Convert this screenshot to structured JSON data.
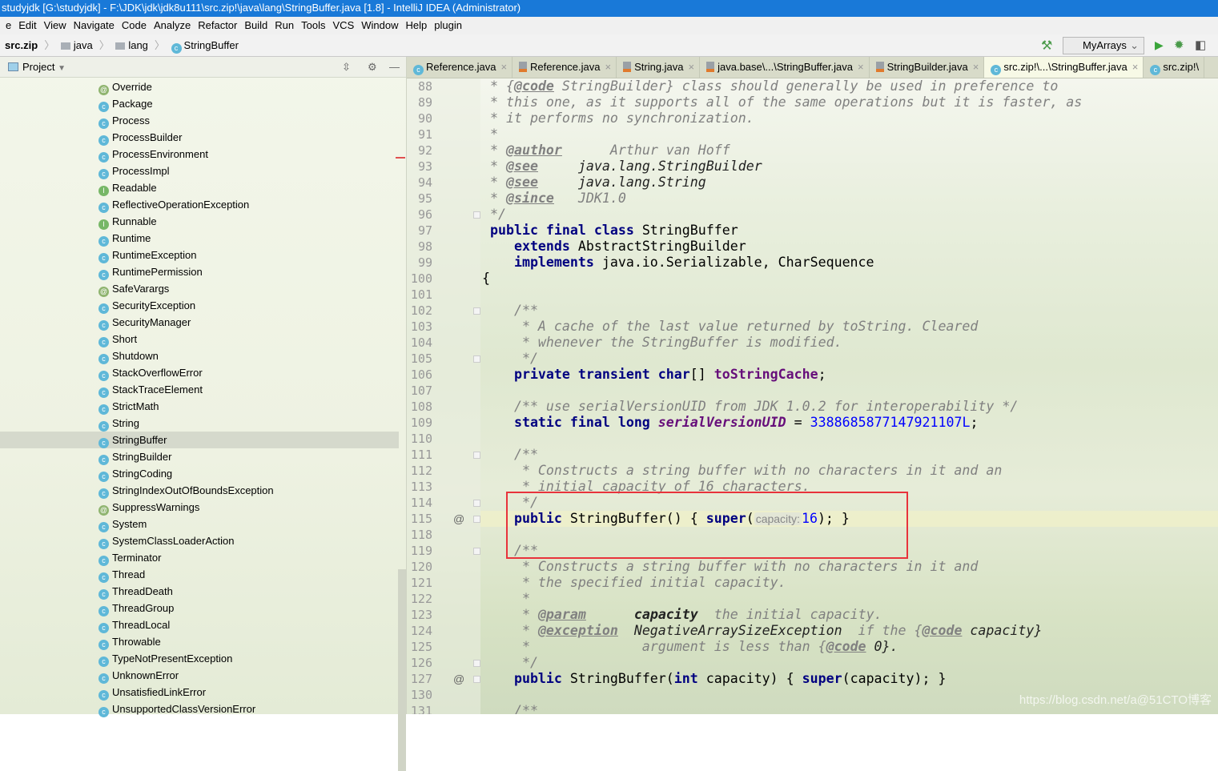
{
  "window": {
    "title": "studyjdk [G:\\studyjdk] - F:\\JDK\\jdk\\jdk8u111\\src.zip!\\java\\lang\\StringBuffer.java [1.8] - IntelliJ IDEA (Administrator)"
  },
  "menu": [
    "e",
    "Edit",
    "View",
    "Navigate",
    "Code",
    "Analyze",
    "Refactor",
    "Build",
    "Run",
    "Tools",
    "VCS",
    "Window",
    "Help",
    "plugin"
  ],
  "breadcrumb": [
    "src.zip",
    "java",
    "lang",
    "StringBuffer"
  ],
  "toolbar": {
    "run_config": "MyArrays"
  },
  "project": {
    "label": "Project"
  },
  "tree": [
    {
      "t": "A",
      "n": "Override"
    },
    {
      "t": "C",
      "n": "Package"
    },
    {
      "t": "C",
      "n": "Process"
    },
    {
      "t": "C",
      "n": "ProcessBuilder"
    },
    {
      "t": "C",
      "n": "ProcessEnvironment"
    },
    {
      "t": "C",
      "n": "ProcessImpl"
    },
    {
      "t": "I",
      "n": "Readable"
    },
    {
      "t": "C",
      "n": "ReflectiveOperationException"
    },
    {
      "t": "I",
      "n": "Runnable"
    },
    {
      "t": "C",
      "n": "Runtime"
    },
    {
      "t": "C",
      "n": "RuntimeException"
    },
    {
      "t": "C",
      "n": "RuntimePermission"
    },
    {
      "t": "A",
      "n": "SafeVarargs"
    },
    {
      "t": "C",
      "n": "SecurityException"
    },
    {
      "t": "C",
      "n": "SecurityManager"
    },
    {
      "t": "C",
      "n": "Short"
    },
    {
      "t": "C",
      "n": "Shutdown"
    },
    {
      "t": "C",
      "n": "StackOverflowError"
    },
    {
      "t": "C",
      "n": "StackTraceElement"
    },
    {
      "t": "C",
      "n": "StrictMath"
    },
    {
      "t": "C",
      "n": "String"
    },
    {
      "t": "C",
      "n": "StringBuffer",
      "selected": true
    },
    {
      "t": "C",
      "n": "StringBuilder"
    },
    {
      "t": "C",
      "n": "StringCoding"
    },
    {
      "t": "C",
      "n": "StringIndexOutOfBoundsException"
    },
    {
      "t": "A",
      "n": "SuppressWarnings"
    },
    {
      "t": "C",
      "n": "System"
    },
    {
      "t": "C",
      "n": "SystemClassLoaderAction"
    },
    {
      "t": "C",
      "n": "Terminator"
    },
    {
      "t": "C",
      "n": "Thread"
    },
    {
      "t": "C",
      "n": "ThreadDeath"
    },
    {
      "t": "C",
      "n": "ThreadGroup"
    },
    {
      "t": "C",
      "n": "ThreadLocal"
    },
    {
      "t": "C",
      "n": "Throwable"
    },
    {
      "t": "C",
      "n": "TypeNotPresentException"
    },
    {
      "t": "C",
      "n": "UnknownError"
    },
    {
      "t": "C",
      "n": "UnsatisfiedLinkError"
    },
    {
      "t": "C",
      "n": "UnsupportedClassVersionError"
    }
  ],
  "tabs": [
    {
      "label": "Reference.java",
      "icon": "c"
    },
    {
      "label": "Reference.java",
      "icon": "j"
    },
    {
      "label": "String.java",
      "icon": "j"
    },
    {
      "label": "java.base\\...\\StringBuffer.java",
      "icon": "j"
    },
    {
      "label": "StringBuilder.java",
      "icon": "j"
    },
    {
      "label": "src.zip!\\...\\StringBuffer.java",
      "icon": "c",
      "active": true
    },
    {
      "label": "src.zip!\\",
      "icon": "c"
    }
  ],
  "editor": {
    "lines": [
      {
        "no": "88",
        "s": [
          [
            " * {",
            "c"
          ],
          [
            "@code",
            "t"
          ],
          [
            " StringBuilder} class should generally be used in preference to",
            "c"
          ]
        ]
      },
      {
        "no": "89",
        "s": [
          [
            " * this one, as it supports all of the same operations but it is faster, as",
            "c"
          ]
        ]
      },
      {
        "no": "90",
        "s": [
          [
            " * it performs no synchronization.",
            "c"
          ]
        ]
      },
      {
        "no": "91",
        "s": [
          [
            " *",
            "c"
          ]
        ]
      },
      {
        "no": "92",
        "s": [
          [
            " * ",
            "c"
          ],
          [
            "@author",
            "t"
          ],
          [
            "      Arthur van Hoff",
            "c"
          ]
        ]
      },
      {
        "no": "93",
        "s": [
          [
            " * ",
            "c"
          ],
          [
            "@see",
            "t"
          ],
          [
            "     java.lang.StringBuilder",
            "cr"
          ]
        ]
      },
      {
        "no": "94",
        "s": [
          [
            " * ",
            "c"
          ],
          [
            "@see",
            "t"
          ],
          [
            "     java.lang.String",
            "cr"
          ]
        ]
      },
      {
        "no": "95",
        "s": [
          [
            " * ",
            "c"
          ],
          [
            "@since",
            "t"
          ],
          [
            "   JDK1.0",
            "c"
          ]
        ]
      },
      {
        "no": "96",
        "s": [
          [
            " */",
            "c"
          ]
        ],
        "fold": true
      },
      {
        "no": "97",
        "s": [
          [
            " public final class ",
            "k"
          ],
          [
            "StringBuffer",
            "n"
          ]
        ]
      },
      {
        "no": "98",
        "s": [
          [
            "    extends ",
            "k"
          ],
          [
            "AbstractStringBuilder",
            "n"
          ]
        ]
      },
      {
        "no": "99",
        "s": [
          [
            "    implements ",
            "k"
          ],
          [
            "java.io.Serializable, CharSequence",
            "n"
          ]
        ]
      },
      {
        "no": "100",
        "s": [
          [
            "{",
            "n"
          ]
        ]
      },
      {
        "no": "101",
        "s": []
      },
      {
        "no": "102",
        "s": [
          [
            "    /**",
            "c"
          ]
        ],
        "fold": true
      },
      {
        "no": "103",
        "s": [
          [
            "     * A cache of the last value returned by toString. Cleared",
            "c"
          ]
        ]
      },
      {
        "no": "104",
        "s": [
          [
            "     * whenever the StringBuffer is modified.",
            "c"
          ]
        ]
      },
      {
        "no": "105",
        "s": [
          [
            "     */",
            "c"
          ]
        ],
        "fold": true
      },
      {
        "no": "106",
        "s": [
          [
            "    private transient char",
            "k"
          ],
          [
            "[] ",
            "n"
          ],
          [
            "toStringCache",
            "p"
          ],
          [
            ";",
            "n"
          ]
        ]
      },
      {
        "no": "107",
        "s": []
      },
      {
        "no": "108",
        "s": [
          [
            "    /** use serialVersionUID from JDK 1.0.2 for interoperability */",
            "c"
          ]
        ]
      },
      {
        "no": "109",
        "s": [
          [
            "    static final long ",
            "k"
          ],
          [
            "serialVersionUID",
            "f"
          ],
          [
            " = ",
            "n"
          ],
          [
            "3388685877147921107L",
            "num"
          ],
          [
            ";",
            "n"
          ]
        ]
      },
      {
        "no": "110",
        "s": []
      },
      {
        "no": "111",
        "s": [
          [
            "    /**",
            "c"
          ]
        ],
        "fold": true
      },
      {
        "no": "112",
        "s": [
          [
            "     * Constructs a string buffer with no characters in it and an",
            "c"
          ]
        ]
      },
      {
        "no": "113",
        "s": [
          [
            "     * initial capacity of 16 characters.",
            "c"
          ]
        ]
      },
      {
        "no": "114",
        "s": [
          [
            "     */",
            "c"
          ]
        ],
        "fold": true
      },
      {
        "no": "115",
        "s": [
          [
            "    public ",
            "k"
          ],
          [
            "StringBuffer() { ",
            "n"
          ],
          [
            "super",
            "k"
          ],
          [
            "(",
            "n"
          ],
          [
            "capacity:",
            "h"
          ],
          [
            "16",
            "num"
          ],
          [
            "); }",
            "n"
          ]
        ],
        "mark": "@",
        "fold": true,
        "current": true
      },
      {
        "no": "118",
        "s": []
      },
      {
        "no": "119",
        "s": [
          [
            "    /**",
            "c"
          ]
        ],
        "fold": true
      },
      {
        "no": "120",
        "s": [
          [
            "     * Constructs a string buffer with no characters in it and",
            "c"
          ]
        ]
      },
      {
        "no": "121",
        "s": [
          [
            "     * the specified initial capacity.",
            "c"
          ]
        ]
      },
      {
        "no": "122",
        "s": [
          [
            "     *",
            "c"
          ]
        ]
      },
      {
        "no": "123",
        "s": [
          [
            "     * ",
            "c"
          ],
          [
            "@param",
            "t"
          ],
          [
            "      ",
            "c"
          ],
          [
            "capacity",
            "cb"
          ],
          [
            "  the initial capacity.",
            "c"
          ]
        ]
      },
      {
        "no": "124",
        "s": [
          [
            "     * ",
            "c"
          ],
          [
            "@exception",
            "t"
          ],
          [
            "  NegativeArraySizeException",
            "cr"
          ],
          [
            "  if the {",
            "c"
          ],
          [
            "@code",
            "t"
          ],
          [
            " capacity}",
            "cr"
          ]
        ]
      },
      {
        "no": "125",
        "s": [
          [
            "     *              argument is less than {",
            "c"
          ],
          [
            "@code",
            "t"
          ],
          [
            " 0}.",
            "cr"
          ]
        ]
      },
      {
        "no": "126",
        "s": [
          [
            "     */",
            "c"
          ]
        ],
        "fold": true
      },
      {
        "no": "127",
        "s": [
          [
            "    public ",
            "k"
          ],
          [
            "StringBuffer(",
            "n"
          ],
          [
            "int ",
            "k"
          ],
          [
            "capacity) { ",
            "n"
          ],
          [
            "super",
            "k"
          ],
          [
            "(capacity); }",
            "n"
          ]
        ],
        "mark": "@",
        "fold": true
      },
      {
        "no": "130",
        "s": []
      },
      {
        "no": "131",
        "s": [
          [
            "    /**",
            "c"
          ]
        ]
      }
    ]
  },
  "watermark": "https://blog.csdn.net/a@51CTO博客",
  "colors": {
    "titlebar": "#1979d8",
    "keyword": "#000080",
    "comment": "#808080",
    "number": "#0000ff",
    "field": "#660e7a",
    "highlight_box": "#e8333b"
  }
}
